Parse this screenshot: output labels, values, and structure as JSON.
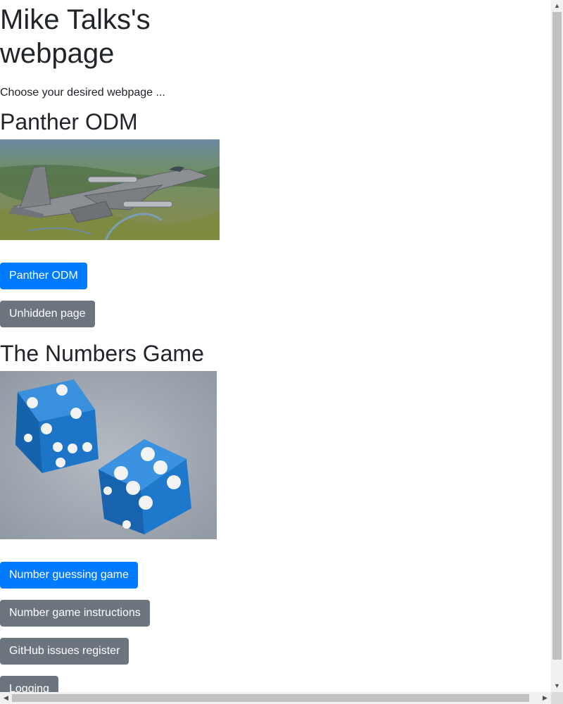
{
  "page": {
    "title": "Mike Talks's webpage",
    "intro": "Choose your desired webpage ..."
  },
  "sections": {
    "panther": {
      "title": "Panther ODM",
      "image_subject": "jet-aircraft-photo",
      "buttons": {
        "primary": "Panther ODM",
        "secondary": "Unhidden page"
      }
    },
    "numbers": {
      "title": "The Numbers Game",
      "image_subject": "blue-dice-photo",
      "buttons": {
        "guessing": "Number guessing game",
        "instructions": "Number game instructions",
        "github": "GitHub issues register",
        "logging": "Logging"
      }
    }
  },
  "colors": {
    "primary": "#007bff",
    "secondary": "#6c757d",
    "text": "#212529"
  },
  "scrollbars": {
    "up_icon": "arrow-up-icon",
    "down_icon": "arrow-down-icon",
    "left_icon": "arrow-left-icon",
    "right_icon": "arrow-right-icon"
  }
}
